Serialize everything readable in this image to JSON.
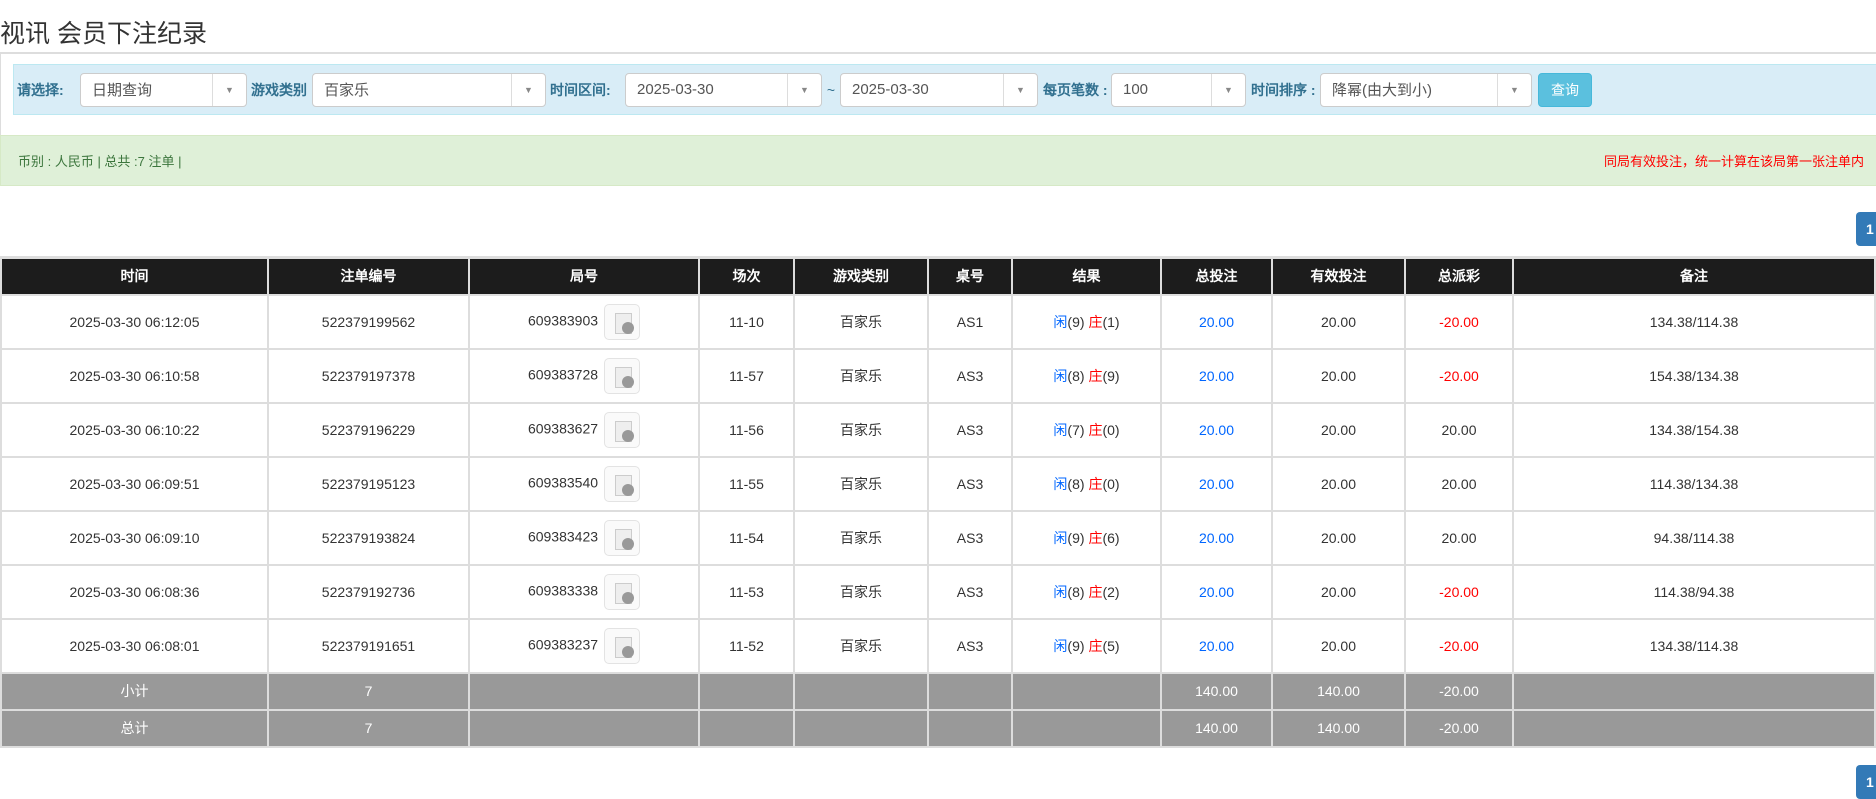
{
  "title": "视讯 会员下注纪录",
  "filters": {
    "select_label": "请选择:",
    "select_value": "日期查询",
    "game_label": "游戏类别",
    "game_value": "百家乐",
    "range_label": "时间区间:",
    "date_from": "2025-03-30",
    "tilde": "~",
    "date_to": "2025-03-30",
    "per_page_label": "每页笔数 :",
    "per_page_value": "100",
    "sort_label": "时间排序 :",
    "sort_value": "降幂(由大到小)",
    "query_button": "查询"
  },
  "summary": {
    "left": "币别 : 人民币 | 总共 :7 注单 |",
    "right": "同局有效投注，统一计算在该局第一张注单内"
  },
  "pagination": {
    "page": "1"
  },
  "table": {
    "headers": [
      "时间",
      "注单编号",
      "局号",
      "场次",
      "游戏类别",
      "桌号",
      "结果",
      "总投注",
      "有效投注",
      "总派彩",
      "备注"
    ],
    "rows": [
      {
        "time": "2025-03-30 06:12:05",
        "id": "522379199562",
        "round": "609383903",
        "session": "11-10",
        "game": "百家乐",
        "table": "AS1",
        "player": "闲",
        "pv": "(9)",
        "banker": "庄",
        "bv": "(1)",
        "bet": "20.00",
        "valid": "20.00",
        "payout": "-20.00",
        "payout_neg": true,
        "note": "134.38/114.38"
      },
      {
        "time": "2025-03-30 06:10:58",
        "id": "522379197378",
        "round": "609383728",
        "session": "11-57",
        "game": "百家乐",
        "table": "AS3",
        "player": "闲",
        "pv": "(8)",
        "banker": "庄",
        "bv": "(9)",
        "bet": "20.00",
        "valid": "20.00",
        "payout": "-20.00",
        "payout_neg": true,
        "note": "154.38/134.38"
      },
      {
        "time": "2025-03-30 06:10:22",
        "id": "522379196229",
        "round": "609383627",
        "session": "11-56",
        "game": "百家乐",
        "table": "AS3",
        "player": "闲",
        "pv": "(7)",
        "banker": "庄",
        "bv": "(0)",
        "bet": "20.00",
        "valid": "20.00",
        "payout": "20.00",
        "payout_neg": false,
        "note": "134.38/154.38"
      },
      {
        "time": "2025-03-30 06:09:51",
        "id": "522379195123",
        "round": "609383540",
        "session": "11-55",
        "game": "百家乐",
        "table": "AS3",
        "player": "闲",
        "pv": "(8)",
        "banker": "庄",
        "bv": "(0)",
        "bet": "20.00",
        "valid": "20.00",
        "payout": "20.00",
        "payout_neg": false,
        "note": "114.38/134.38"
      },
      {
        "time": "2025-03-30 06:09:10",
        "id": "522379193824",
        "round": "609383423",
        "session": "11-54",
        "game": "百家乐",
        "table": "AS3",
        "player": "闲",
        "pv": "(9)",
        "banker": "庄",
        "bv": "(6)",
        "bet": "20.00",
        "valid": "20.00",
        "payout": "20.00",
        "payout_neg": false,
        "note": "94.38/114.38"
      },
      {
        "time": "2025-03-30 06:08:36",
        "id": "522379192736",
        "round": "609383338",
        "session": "11-53",
        "game": "百家乐",
        "table": "AS3",
        "player": "闲",
        "pv": "(8)",
        "banker": "庄",
        "bv": "(2)",
        "bet": "20.00",
        "valid": "20.00",
        "payout": "-20.00",
        "payout_neg": true,
        "note": "114.38/94.38"
      },
      {
        "time": "2025-03-30 06:08:01",
        "id": "522379191651",
        "round": "609383237",
        "session": "11-52",
        "game": "百家乐",
        "table": "AS3",
        "player": "闲",
        "pv": "(9)",
        "banker": "庄",
        "bv": "(5)",
        "bet": "20.00",
        "valid": "20.00",
        "payout": "-20.00",
        "payout_neg": true,
        "note": "134.38/114.38"
      }
    ],
    "subtotal": {
      "label": "小计",
      "count": "7",
      "bet": "140.00",
      "valid": "140.00",
      "payout": "-20.00"
    },
    "total": {
      "label": "总计",
      "count": "7",
      "bet": "140.00",
      "valid": "140.00",
      "payout": "-20.00"
    }
  }
}
